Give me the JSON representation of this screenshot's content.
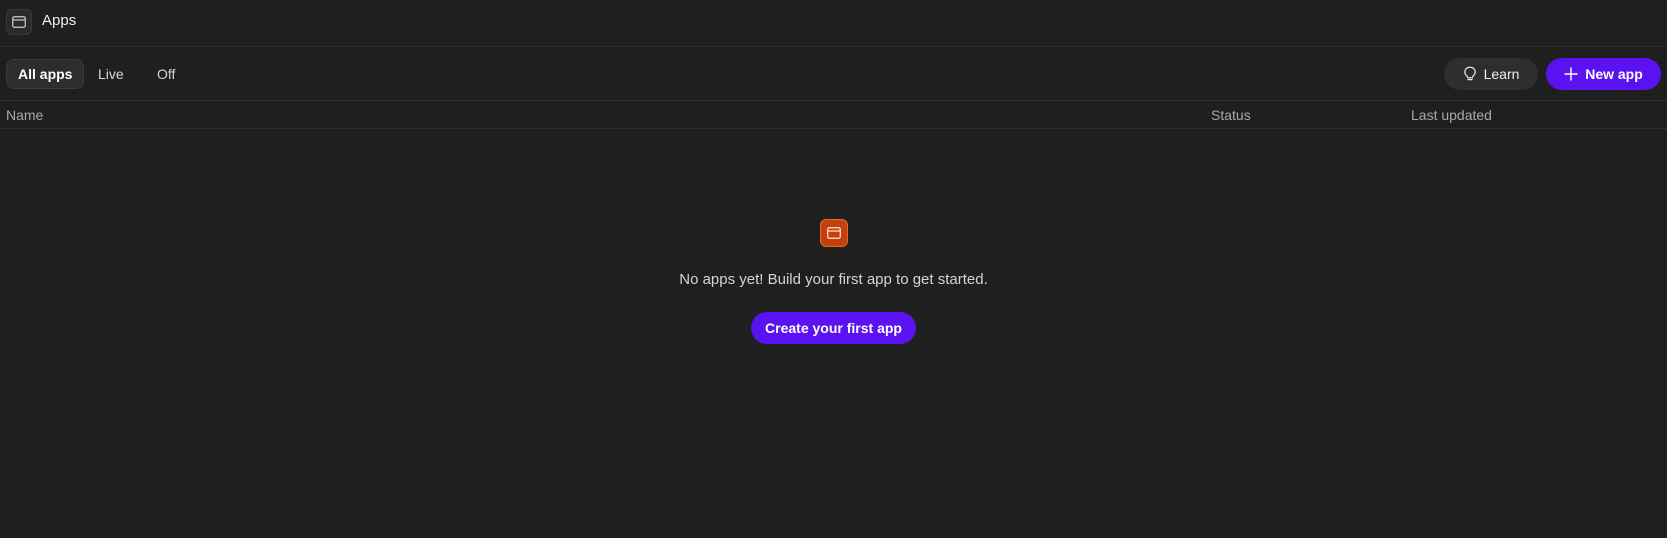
{
  "window": {
    "title": "Apps",
    "icon": "app-window-icon"
  },
  "toolbar": {
    "tabs": [
      {
        "label": "All apps",
        "active": true
      },
      {
        "label": "Live",
        "active": false
      },
      {
        "label": "Off",
        "active": false
      }
    ],
    "learn_label": "Learn",
    "learn_icon": "lightbulb-icon",
    "new_app_label": "New app",
    "new_app_icon": "plus-icon"
  },
  "table": {
    "columns": [
      "Name",
      "Status",
      "Last updated"
    ],
    "rows": []
  },
  "empty_state": {
    "icon": "app-window-icon",
    "message": "No apps yet! Build your first app to get started.",
    "button_label": "Create your first app"
  },
  "colors": {
    "background": "#1f1f1f",
    "accent": "#5b12f0",
    "empty_icon": "#c2410c"
  }
}
